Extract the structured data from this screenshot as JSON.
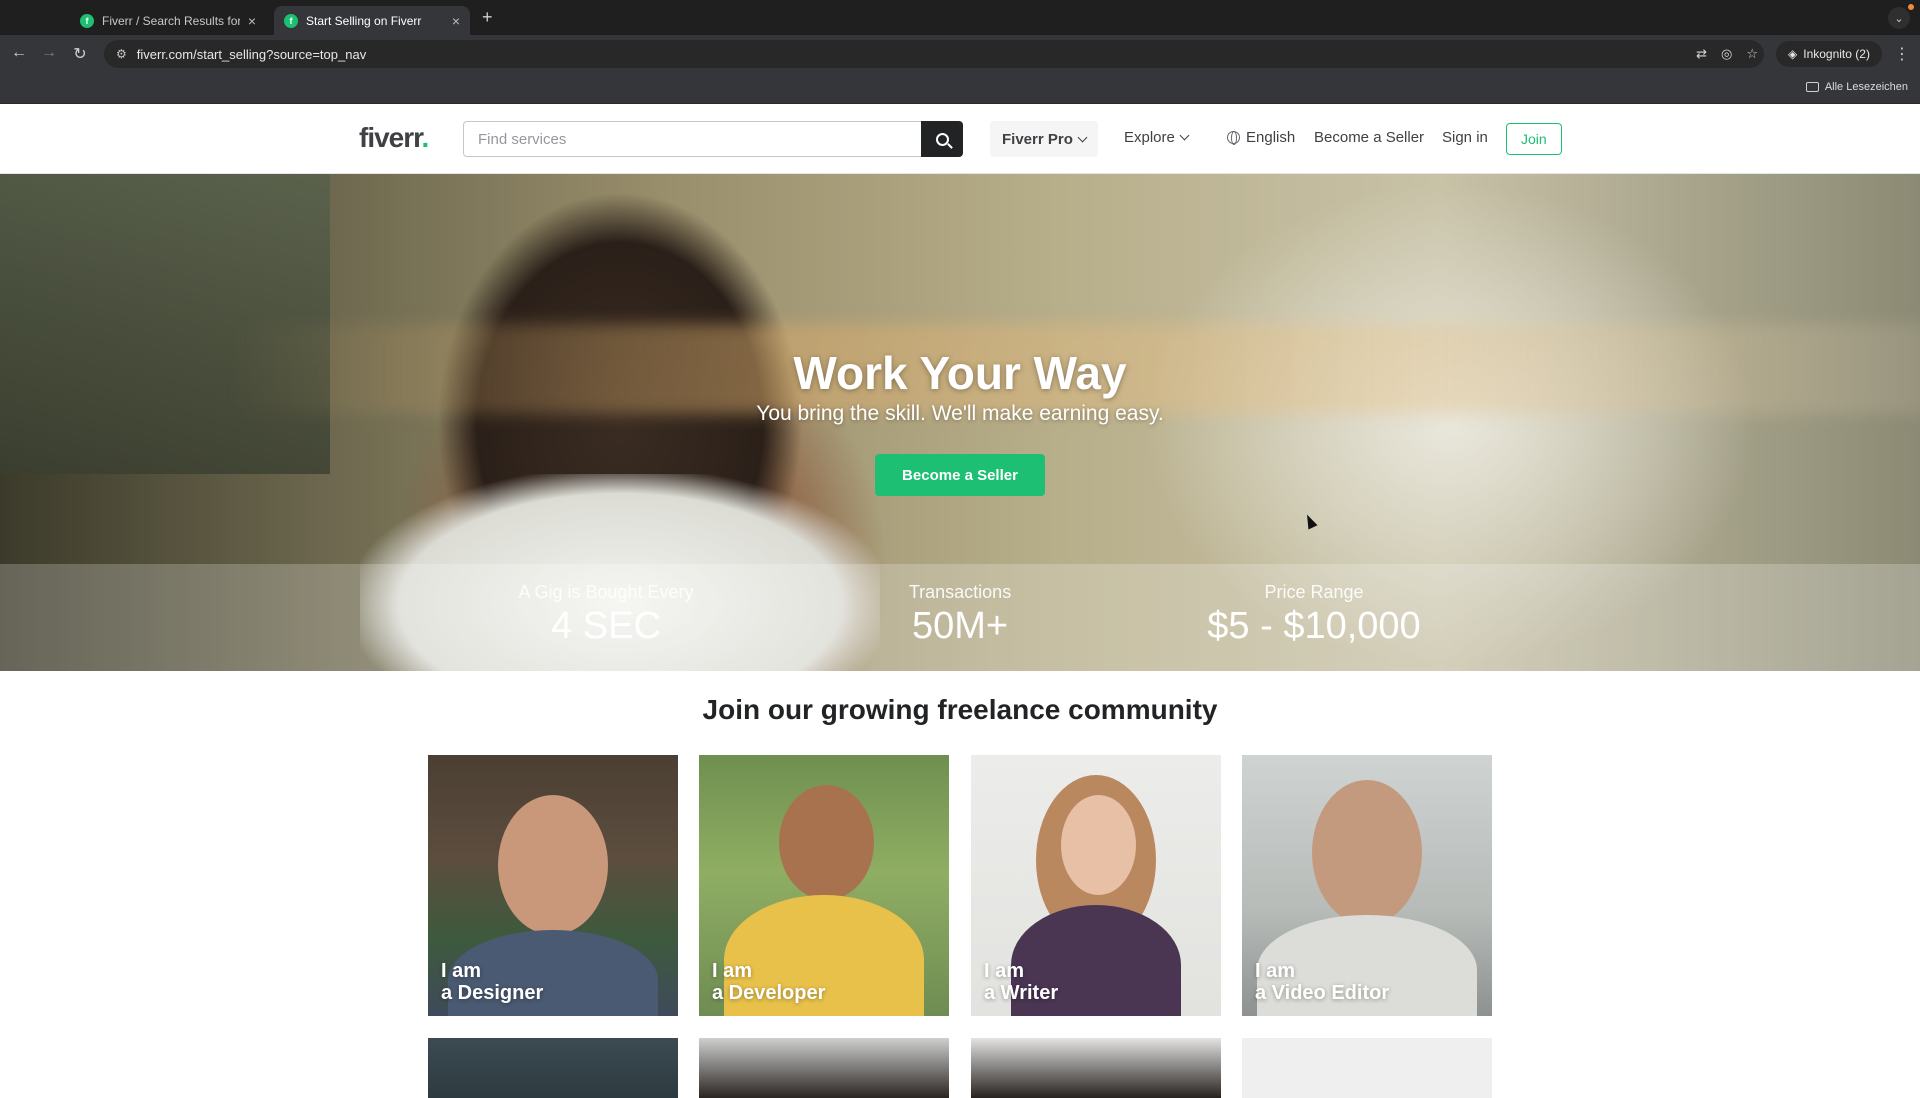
{
  "browser": {
    "tabs": [
      {
        "title": "Fiverr / Search Results for 'm",
        "active": false
      },
      {
        "title": "Start Selling on Fiverr",
        "active": true
      }
    ],
    "new_tab": "+",
    "url": "fiverr.com/start_selling?source=top_nav",
    "incognito_label": "Inkognito (2)",
    "bookmarks_label": "Alle Lesezeichen"
  },
  "header": {
    "logo_text": "fiverr",
    "logo_dot": ".",
    "search_placeholder": "Find services",
    "fiverr_pro": "Fiverr Pro",
    "explore": "Explore",
    "language": "English",
    "become_seller": "Become a Seller",
    "sign_in": "Sign in",
    "join": "Join"
  },
  "hero": {
    "title": "Work Your Way",
    "subtitle": "You bring the skill. We'll make earning easy.",
    "cta": "Become a Seller",
    "stats": [
      {
        "label": "A Gig is Bought Every",
        "value": "4 SEC"
      },
      {
        "label": "Transactions",
        "value": "50M+"
      },
      {
        "label": "Price Range",
        "value": "$5 - $10,000"
      }
    ]
  },
  "community": {
    "title": "Join our growing freelance community",
    "cards": [
      {
        "line1": "I am",
        "line2": "a Designer"
      },
      {
        "line1": "I am",
        "line2": "a Developer"
      },
      {
        "line1": "I am",
        "line2": "a Writer"
      },
      {
        "line1": "I am",
        "line2": "a Video Editor"
      }
    ]
  },
  "colors": {
    "brand_green": "#1dbf73",
    "text_dark": "#404145",
    "chrome_dark": "#1f1f1f"
  }
}
